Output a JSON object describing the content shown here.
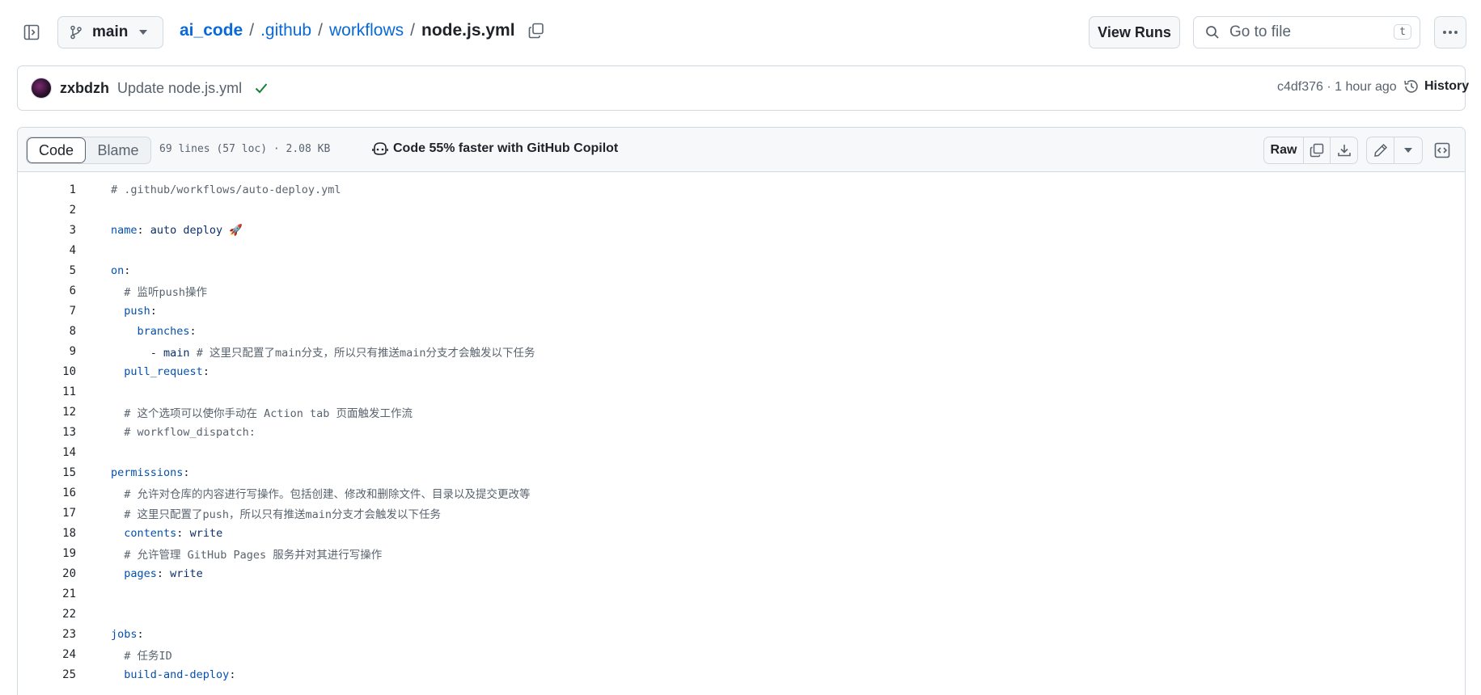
{
  "topbar": {
    "branch": "main",
    "breadcrumb": {
      "repo": "ai_code",
      "dir1": ".github",
      "dir2": "workflows",
      "file": "node.js.yml",
      "sep": "/"
    },
    "view_runs": "View Runs",
    "goto_placeholder": "Go to file",
    "goto_kbd": "t"
  },
  "commit": {
    "author": "zxbdzh",
    "message": "Update node.js.yml",
    "meta": "c4df376 · 1 hour ago",
    "history": "History"
  },
  "file": {
    "tabs": {
      "code": "Code",
      "blame": "Blame"
    },
    "info": "69 lines (57 loc) · 2.08 KB",
    "copilot": "Code 55% faster with GitHub Copilot",
    "raw": "Raw"
  },
  "lines": [
    {
      "n": "1",
      "parts": [
        [
          "c",
          "# .github/workflows/auto-deploy.yml"
        ]
      ]
    },
    {
      "n": "2",
      "parts": []
    },
    {
      "n": "3",
      "parts": [
        [
          "k",
          "name"
        ],
        [
          "d",
          ": "
        ],
        [
          "s",
          "auto deploy 🚀"
        ]
      ]
    },
    {
      "n": "4",
      "parts": []
    },
    {
      "n": "5",
      "parts": [
        [
          "k",
          "on"
        ],
        [
          "d",
          ":"
        ]
      ]
    },
    {
      "n": "6",
      "parts": [
        [
          "d",
          "  "
        ],
        [
          "c",
          "# 监听push操作"
        ]
      ]
    },
    {
      "n": "7",
      "parts": [
        [
          "d",
          "  "
        ],
        [
          "k",
          "push"
        ],
        [
          "d",
          ":"
        ]
      ]
    },
    {
      "n": "8",
      "parts": [
        [
          "d",
          "    "
        ],
        [
          "k",
          "branches"
        ],
        [
          "d",
          ":"
        ]
      ]
    },
    {
      "n": "9",
      "parts": [
        [
          "d",
          "      - "
        ],
        [
          "s",
          "main"
        ],
        [
          "d",
          " "
        ],
        [
          "c",
          "# 这里只配置了main分支，所以只有推送main分支才会触发以下任务"
        ]
      ]
    },
    {
      "n": "10",
      "parts": [
        [
          "d",
          "  "
        ],
        [
          "k",
          "pull_request"
        ],
        [
          "d",
          ":"
        ]
      ]
    },
    {
      "n": "11",
      "parts": []
    },
    {
      "n": "12",
      "parts": [
        [
          "d",
          "  "
        ],
        [
          "c",
          "# 这个选项可以使你手动在 Action tab 页面触发工作流"
        ]
      ]
    },
    {
      "n": "13",
      "parts": [
        [
          "d",
          "  "
        ],
        [
          "c",
          "# workflow_dispatch:"
        ]
      ]
    },
    {
      "n": "14",
      "parts": []
    },
    {
      "n": "15",
      "parts": [
        [
          "k",
          "permissions"
        ],
        [
          "d",
          ":"
        ]
      ]
    },
    {
      "n": "16",
      "parts": [
        [
          "d",
          "  "
        ],
        [
          "c",
          "# 允许对仓库的内容进行写操作。包括创建、修改和删除文件、目录以及提交更改等"
        ]
      ]
    },
    {
      "n": "17",
      "parts": [
        [
          "d",
          "  "
        ],
        [
          "c",
          "# 这里只配置了push，所以只有推送main分支才会触发以下任务"
        ]
      ]
    },
    {
      "n": "18",
      "parts": [
        [
          "d",
          "  "
        ],
        [
          "k",
          "contents"
        ],
        [
          "d",
          ": "
        ],
        [
          "s",
          "write"
        ]
      ]
    },
    {
      "n": "19",
      "parts": [
        [
          "d",
          "  "
        ],
        [
          "c",
          "# 允许管理 GitHub Pages 服务并对其进行写操作"
        ]
      ]
    },
    {
      "n": "20",
      "parts": [
        [
          "d",
          "  "
        ],
        [
          "k",
          "pages"
        ],
        [
          "d",
          ": "
        ],
        [
          "s",
          "write"
        ]
      ]
    },
    {
      "n": "21",
      "parts": []
    },
    {
      "n": "22",
      "parts": []
    },
    {
      "n": "23",
      "parts": [
        [
          "k",
          "jobs"
        ],
        [
          "d",
          ":"
        ]
      ]
    },
    {
      "n": "24",
      "parts": [
        [
          "d",
          "  "
        ],
        [
          "c",
          "# 任务ID"
        ]
      ]
    },
    {
      "n": "25",
      "parts": [
        [
          "d",
          "  "
        ],
        [
          "k",
          "build-and-deploy"
        ],
        [
          "d",
          ":"
        ]
      ]
    }
  ]
}
